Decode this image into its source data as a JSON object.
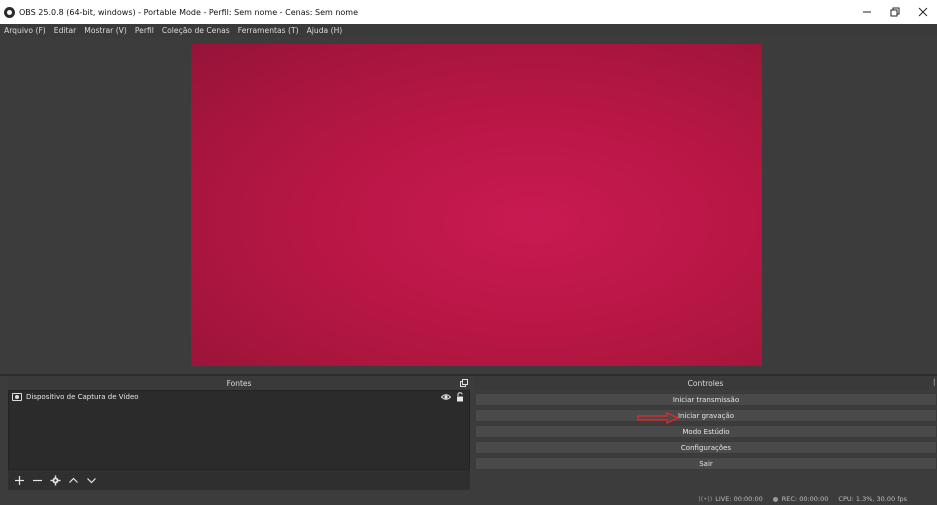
{
  "window": {
    "title": "OBS 25.0.8 (64-bit, windows) - Portable Mode - Perfil: Sem nome - Cenas: Sem nome",
    "minimize": "–",
    "restore": "❐",
    "close": "✕"
  },
  "menu": {
    "items": [
      "Arquivo (F)",
      "Editar",
      "Mostrar (V)",
      "Perfil",
      "Coleção de Cenas",
      "Ferramentas (T)",
      "Ajuda (H)"
    ]
  },
  "preview": {
    "color": "#b81644"
  },
  "sources": {
    "title": "Fontes",
    "items": [
      {
        "label": "Dispositivo de Captura de Vídeo",
        "icon": "camera-icon",
        "visible": true,
        "locked": false
      }
    ],
    "toolbar": {
      "add": "+",
      "remove": "—",
      "settings": "⚙",
      "up": "^",
      "down": "v"
    }
  },
  "controls": {
    "title": "Controles",
    "buttons": [
      "Iniciar transmissão",
      "Iniciar gravação",
      "Modo Estúdio",
      "Configurações",
      "Sair"
    ]
  },
  "annotation": {
    "arrow_color": "#e8262a"
  },
  "status": {
    "live": "LIVE: 00:00:00",
    "rec": "REC: 00:00:00",
    "cpu": "CPU: 1.3%, 30.00 fps"
  }
}
